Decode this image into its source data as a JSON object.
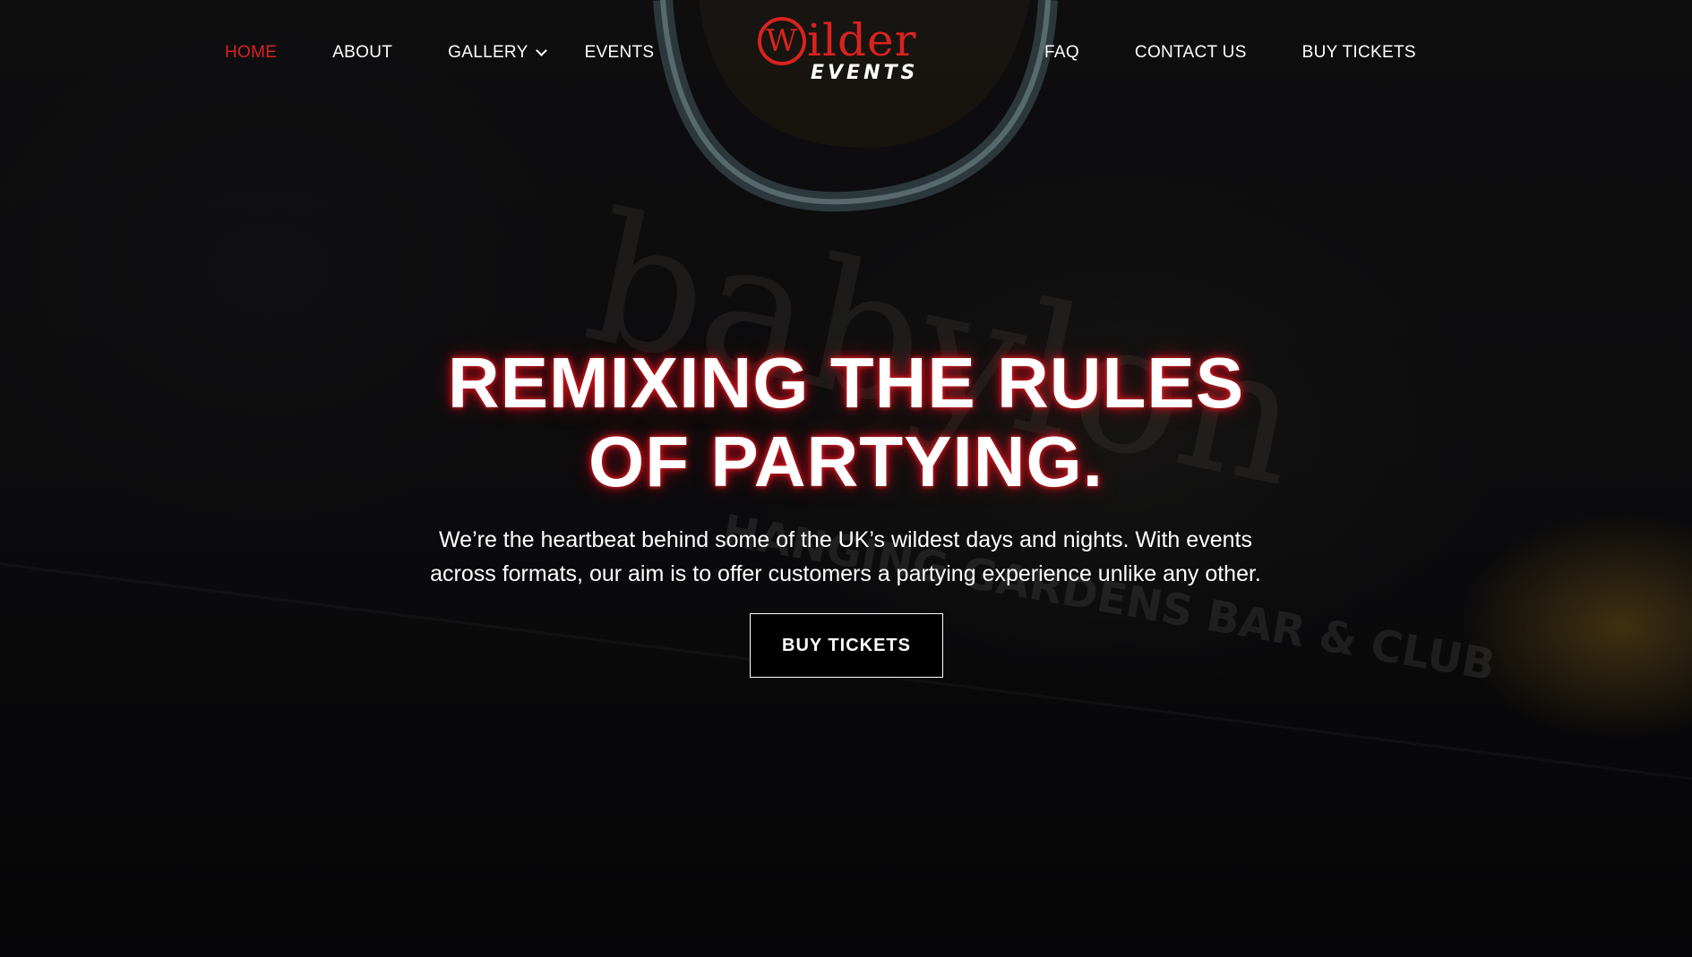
{
  "nav": {
    "left": [
      {
        "label": "HOME",
        "active": true
      },
      {
        "label": "ABOUT"
      },
      {
        "label": "GALLERY",
        "has_dropdown": true
      },
      {
        "label": "EVENTS"
      }
    ],
    "right": [
      {
        "label": "FAQ"
      },
      {
        "label": "CONTACT US"
      },
      {
        "label": "BUY TICKETS"
      }
    ]
  },
  "logo": {
    "initial": "W",
    "rest": "ilder",
    "subtitle": "EVENTS"
  },
  "hero": {
    "headline_line1": "REMIXING THE RULES",
    "headline_line2": "OF PARTYING.",
    "subtext_line1": "We’re the heartbeat behind some of the UK’s wildest days and nights. With events",
    "subtext_line2": "across formats, our aim is to offer customers a partying experience unlike any other.",
    "cta_label": "BUY TICKETS"
  },
  "colors": {
    "accent": "#d9231f",
    "text": "#ffffff",
    "background": "#0b0b0d"
  },
  "icons": {
    "dropdown": "chevron-down-icon"
  }
}
